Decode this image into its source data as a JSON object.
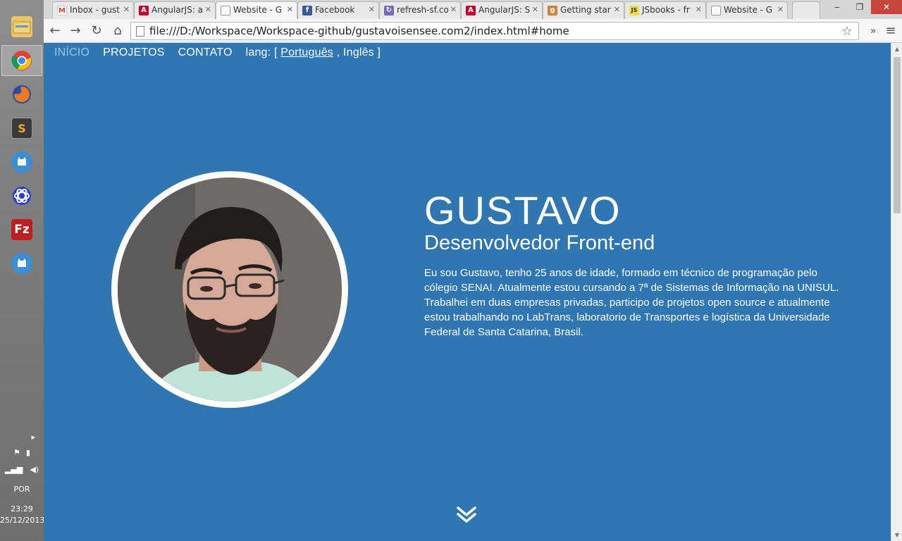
{
  "taskbar": {
    "apps": [
      {
        "name": "file-explorer",
        "icon": "folder-icon",
        "color": "#e9c66b"
      },
      {
        "name": "chrome",
        "icon": "chrome-icon",
        "color": "#4a8af4",
        "active": true
      },
      {
        "name": "firefox",
        "icon": "firefox-icon",
        "color": "#e66c25"
      },
      {
        "name": "sublime-text",
        "icon": "sublime-icon",
        "color": "#444444"
      },
      {
        "name": "app-cat-1",
        "icon": "cat-icon",
        "color": "#3a8fd6"
      },
      {
        "name": "eclipse-like",
        "icon": "ring-icon",
        "color": "#2b3ed1"
      },
      {
        "name": "filezilla",
        "icon": "filezilla-icon",
        "color": "#bf1e1e"
      },
      {
        "name": "app-cat-2",
        "icon": "cat-icon",
        "color": "#3a8fd6"
      }
    ],
    "tray": {
      "language": "POR",
      "time": "23:29",
      "date": "25/12/2013"
    }
  },
  "browser": {
    "tabs": [
      {
        "label": "Inbox - gust",
        "favicon": "gmail-icon",
        "color": "#d44638"
      },
      {
        "label": "AngularJS: a",
        "favicon": "angular-icon",
        "color": "#c3002f"
      },
      {
        "label": "Website - G",
        "favicon": "page-icon",
        "color": "#ffffff",
        "active": true
      },
      {
        "label": "Facebook",
        "favicon": "facebook-icon",
        "color": "#3b5998"
      },
      {
        "label": "refresh-sf.co",
        "favicon": "refresh-icon",
        "color": "#7a6bb2"
      },
      {
        "label": "AngularJS: S",
        "favicon": "angular-icon",
        "color": "#c3002f"
      },
      {
        "label": "Getting star",
        "favicon": "gitbook-icon",
        "color": "#c8843c"
      },
      {
        "label": "JSbooks - fr",
        "favicon": "js-icon",
        "color": "#f0db4f"
      },
      {
        "label": "Website - G",
        "favicon": "page-icon",
        "color": "#ffffff"
      }
    ],
    "address": "file:///D:/Workspace/Workspace-github/gustavoisensee.com2/index.html#home"
  },
  "site": {
    "nav": {
      "items": [
        "INÍCIO",
        "PROJETOS",
        "CONTATO"
      ],
      "lang_prefix": "lang: [",
      "lang_current": "Português",
      "lang_sep": ",",
      "lang_other": "Inglês",
      "lang_suffix": "]"
    },
    "hero": {
      "name": "GUSTAVO",
      "role": "Desenvolvedor Front-end",
      "bio": "Eu sou Gustavo, tenho 25 anos de idade, formado em técnico de programação pelo cólegio SENAI. Atualmente estou cursando a 7ª de Sistemas de Informação na UNISUL. Trabalhei em duas empresas privadas, participo de projetos open source e atualmente estou trabalhando no LabTrans, laboratorio de Transportes e logística da Universidade Federal de Santa Catarina, Brasil."
    },
    "colors": {
      "background": "#3076b3",
      "nav_active": "#9dc4e6",
      "text": "#ffffff"
    }
  }
}
